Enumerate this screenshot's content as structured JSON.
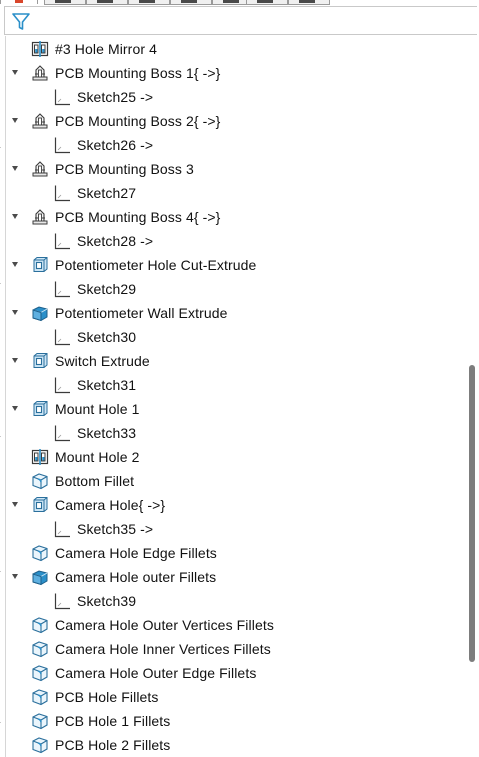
{
  "filter": {
    "icon": "filter-icon"
  },
  "tree": {
    "items": [
      {
        "label": "#3 Hole Mirror 4",
        "icon": "hole-series-icon",
        "expanded": null,
        "level": 0
      },
      {
        "label": "PCB Mounting Boss 1{ ->}",
        "icon": "mounting-boss-icon",
        "expanded": true,
        "level": 0
      },
      {
        "label": "Sketch25 ->",
        "icon": "sketch-icon",
        "expanded": null,
        "level": 1
      },
      {
        "label": "PCB Mounting Boss 2{ ->}",
        "icon": "mounting-boss-icon",
        "expanded": true,
        "level": 0
      },
      {
        "label": "Sketch26 ->",
        "icon": "sketch-icon",
        "expanded": null,
        "level": 1
      },
      {
        "label": "PCB Mounting Boss 3",
        "icon": "mounting-boss-icon",
        "expanded": true,
        "level": 0
      },
      {
        "label": "Sketch27",
        "icon": "sketch-icon",
        "expanded": null,
        "level": 1
      },
      {
        "label": "PCB Mounting Boss 4{ ->}",
        "icon": "mounting-boss-icon",
        "expanded": true,
        "level": 0
      },
      {
        "label": "Sketch28 ->",
        "icon": "sketch-icon",
        "expanded": null,
        "level": 1
      },
      {
        "label": "Potentiometer Hole Cut-Extrude",
        "icon": "cut-extrude-icon",
        "expanded": true,
        "level": 0
      },
      {
        "label": "Sketch29",
        "icon": "sketch-icon",
        "expanded": null,
        "level": 1
      },
      {
        "label": "Potentiometer Wall Extrude",
        "icon": "boss-extrude-icon",
        "expanded": true,
        "level": 0
      },
      {
        "label": "Sketch30",
        "icon": "sketch-icon",
        "expanded": null,
        "level": 1
      },
      {
        "label": "Switch Extrude",
        "icon": "cut-extrude-icon",
        "expanded": true,
        "level": 0
      },
      {
        "label": "Sketch31",
        "icon": "sketch-icon",
        "expanded": null,
        "level": 1
      },
      {
        "label": "Mount Hole 1",
        "icon": "cut-extrude-icon",
        "expanded": true,
        "level": 0
      },
      {
        "label": "Sketch33",
        "icon": "sketch-icon",
        "expanded": null,
        "level": 1
      },
      {
        "label": "Mount Hole 2",
        "icon": "hole-series-icon",
        "expanded": null,
        "level": 0
      },
      {
        "label": "Bottom Fillet",
        "icon": "fillet-icon",
        "expanded": null,
        "level": 0
      },
      {
        "label": "Camera Hole{ ->}",
        "icon": "cut-extrude-icon",
        "expanded": true,
        "level": 0
      },
      {
        "label": "Sketch35 ->",
        "icon": "sketch-icon",
        "expanded": null,
        "level": 1
      },
      {
        "label": "Camera Hole Edge Fillets",
        "icon": "fillet-icon",
        "expanded": null,
        "level": 0
      },
      {
        "label": "Camera Hole outer Fillets",
        "icon": "boss-extrude-icon",
        "expanded": true,
        "level": 0
      },
      {
        "label": "Sketch39",
        "icon": "sketch-icon",
        "expanded": null,
        "level": 1
      },
      {
        "label": "Camera Hole Outer Vertices Fillets",
        "icon": "fillet-icon",
        "expanded": null,
        "level": 0
      },
      {
        "label": "Camera Hole Inner Vertices Fillets",
        "icon": "fillet-icon",
        "expanded": null,
        "level": 0
      },
      {
        "label": "Camera Hole Outer Edge Fillets",
        "icon": "fillet-icon",
        "expanded": null,
        "level": 0
      },
      {
        "label": "PCB Hole Fillets",
        "icon": "fillet-icon",
        "expanded": null,
        "level": 0
      },
      {
        "label": "PCB Hole 1 Fillets",
        "icon": "fillet-icon",
        "expanded": null,
        "level": 0
      },
      {
        "label": "PCB Hole 2 Fillets",
        "icon": "fillet-icon",
        "expanded": null,
        "level": 0
      }
    ]
  },
  "colors": {
    "accent": "#2a8fc9",
    "icon_fill": "#cde6f6",
    "text": "#111111"
  }
}
